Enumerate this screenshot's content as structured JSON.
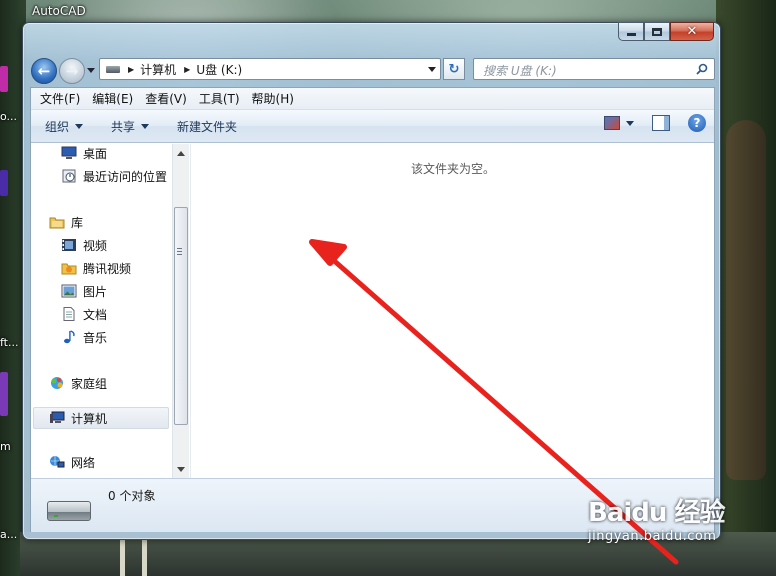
{
  "desktop": {
    "app_title": "AutoCAD",
    "side_labels": [
      "o...",
      "ft...",
      "m",
      "a..."
    ]
  },
  "window": {
    "address": {
      "segments": [
        "计算机",
        "U盘 (K:)"
      ]
    },
    "search": {
      "placeholder": "搜索 U盘 (K:)"
    },
    "menubar": [
      "文件(F)",
      "编辑(E)",
      "查看(V)",
      "工具(T)",
      "帮助(H)"
    ],
    "toolbar": {
      "organize": "组织",
      "share": "共享",
      "new_folder": "新建文件夹"
    },
    "nav_pane": {
      "favorites": [
        {
          "label": "桌面",
          "icon": "desktop-icon"
        },
        {
          "label": "最近访问的位置",
          "icon": "recent-places-icon"
        }
      ],
      "libraries": {
        "label": "库",
        "icon": "library-folder-icon",
        "items": [
          {
            "label": "视频",
            "icon": "video-icon"
          },
          {
            "label": "腾讯视频",
            "icon": "folder-icon"
          },
          {
            "label": "图片",
            "icon": "pictures-icon"
          },
          {
            "label": "文档",
            "icon": "documents-icon"
          },
          {
            "label": "音乐",
            "icon": "music-icon"
          }
        ]
      },
      "homegroup": {
        "label": "家庭组",
        "icon": "homegroup-icon"
      },
      "computer": {
        "label": "计算机",
        "icon": "computer-icon",
        "selected": true
      },
      "network": {
        "label": "网络",
        "icon": "network-icon"
      }
    },
    "content": {
      "empty_message": "该文件夹为空。"
    },
    "details": {
      "object_count": "0 个对象",
      "icon": "usb-drive-icon"
    }
  },
  "annotation": {
    "arrow_color": "#e8231e"
  },
  "watermark": {
    "logo": "Baidu 经验",
    "url": "jingyan.baidu.com"
  }
}
